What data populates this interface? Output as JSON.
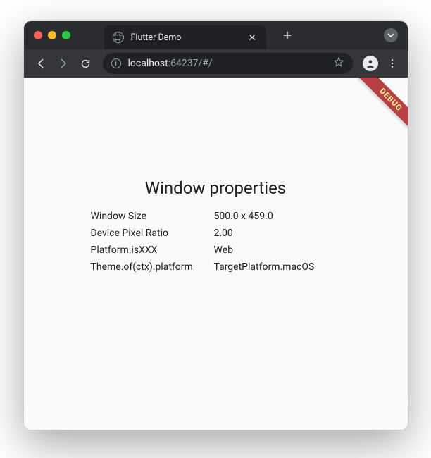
{
  "titlebar": {
    "tab_title": "Flutter Demo"
  },
  "toolbar": {
    "url_host": "localhost",
    "url_port": ":64237/#/"
  },
  "content": {
    "debug_banner": "DEBUG",
    "heading": "Window properties",
    "rows": [
      {
        "label": "Window Size",
        "value": "500.0 x 459.0"
      },
      {
        "label": "Device Pixel Ratio",
        "value": "2.00"
      },
      {
        "label": "Platform.isXXX",
        "value": "Web"
      },
      {
        "label": "Theme.of(ctx).platform",
        "value": "TargetPlatform.macOS"
      }
    ]
  }
}
